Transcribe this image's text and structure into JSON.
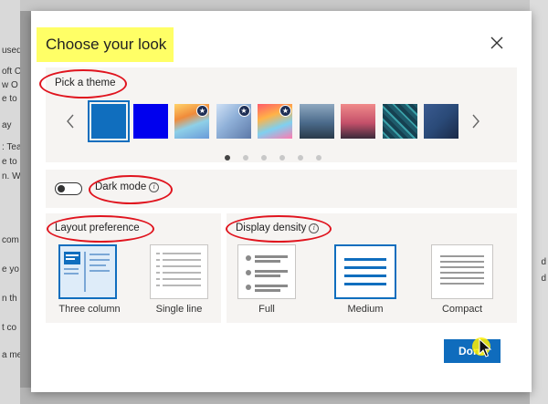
{
  "background": {
    "left_fragments": [
      "used",
      "oft C",
      "w O",
      "e to",
      "ay",
      ": Tea",
      "e to",
      "n. W",
      "com",
      "e yo",
      "n th",
      "t co",
      "a me"
    ],
    "right_fragments": [
      "d",
      "d"
    ]
  },
  "dialog": {
    "title": "Choose your look",
    "close_label": "Close"
  },
  "theme": {
    "section_label": "Pick a theme",
    "prev_label": "Previous themes",
    "next_label": "Next themes",
    "swatches": [
      {
        "color": "#106ebe",
        "selected": true,
        "badge": false
      },
      {
        "color": "#0000ee",
        "selected": false,
        "badge": false
      },
      {
        "color": "#e8a04a",
        "selected": false,
        "badge": true
      },
      {
        "color": "#8fb0d8",
        "selected": false,
        "badge": true
      },
      {
        "color": "#f2a23a",
        "selected": false,
        "badge": true
      },
      {
        "color": "#4a6a8a",
        "selected": false,
        "badge": false
      },
      {
        "color": "#c4506a",
        "selected": false,
        "badge": false
      },
      {
        "color": "#1e5a6a",
        "selected": false,
        "badge": false
      },
      {
        "color": "#2a4a78",
        "selected": false,
        "badge": false
      }
    ],
    "page_count": 6,
    "active_page": 1
  },
  "dark_mode": {
    "label": "Dark mode",
    "enabled": false
  },
  "layout": {
    "section_label": "Layout preference",
    "options": [
      {
        "label": "Three column",
        "selected": true
      },
      {
        "label": "Single line",
        "selected": false
      }
    ]
  },
  "density": {
    "section_label": "Display density",
    "options": [
      {
        "label": "Full",
        "selected": false
      },
      {
        "label": "Medium",
        "selected": true
      },
      {
        "label": "Compact",
        "selected": false
      }
    ]
  },
  "footer": {
    "done_label": "Done"
  },
  "colors": {
    "accent": "#0f6cbd",
    "annotation_red": "#e0141e",
    "highlight_yellow": "#ffff66"
  }
}
